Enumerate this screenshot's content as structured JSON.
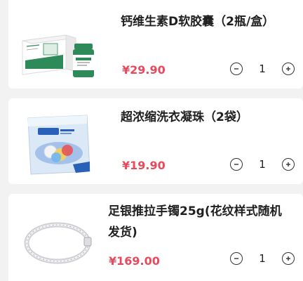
{
  "items": [
    {
      "title": "钙维生素D软胶囊（2瓶/盒）",
      "price": "¥29.90",
      "quantity": "1",
      "minus_icon": "minus-icon",
      "plus_icon": "plus-icon"
    },
    {
      "title": "超浓缩洗衣凝珠（2袋）",
      "price": "¥19.90",
      "quantity": "1",
      "minus_icon": "minus-icon",
      "plus_icon": "plus-icon"
    },
    {
      "title": "足银推拉手镯25g(花纹样式随机发货)",
      "price": "¥169.00",
      "quantity": "1",
      "minus_icon": "minus-icon",
      "plus_icon": "plus-icon"
    }
  ],
  "colors": {
    "price": "#e84a5c",
    "background": "#f2f2f2",
    "card": "#ffffff",
    "supplement_green": "#2f8a5a"
  }
}
